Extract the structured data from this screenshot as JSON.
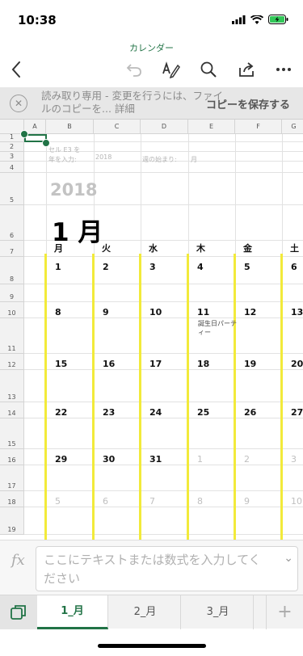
{
  "status": {
    "time": "10:38"
  },
  "app": {
    "title": "カレンダー"
  },
  "banner": {
    "message": "読み取り専用 - 変更を行うには、ファイルのコピーを... 詳細",
    "save_label": "コピーを保存する"
  },
  "sheet": {
    "columns": [
      "A",
      "B",
      "C",
      "D",
      "E",
      "F",
      "G"
    ],
    "rows": [
      "1",
      "2",
      "3",
      "4",
      "5",
      "6",
      "7",
      "8",
      "9",
      "10",
      "11",
      "12",
      "13",
      "14",
      "15",
      "16",
      "17",
      "18",
      "19"
    ],
    "b2": "セル E3 を",
    "b3": "年を入力:",
    "c3": "2018",
    "d3": "週の始まり:",
    "e3": "月",
    "year": "2018",
    "month": "1 月",
    "weekdays": [
      "月",
      "火",
      "水",
      "木",
      "金",
      "土"
    ],
    "week1": [
      "1",
      "2",
      "3",
      "4",
      "5",
      "6"
    ],
    "week2": [
      "8",
      "9",
      "10",
      "11",
      "12",
      "13"
    ],
    "week3": [
      "15",
      "16",
      "17",
      "18",
      "19",
      "20"
    ],
    "week4": [
      "22",
      "23",
      "24",
      "25",
      "26",
      "27"
    ],
    "week5": [
      "29",
      "30",
      "31",
      "1",
      "2",
      "3"
    ],
    "week6": [
      "5",
      "6",
      "7",
      "8",
      "9",
      "10"
    ],
    "note": "誕生日パーティー",
    "highlight_color": "#f2ea3a",
    "selection_color": "#217346"
  },
  "formula": {
    "placeholder": "ここにテキストまたは数式を入力してください"
  },
  "tabs": [
    {
      "label": "1_月",
      "active": true
    },
    {
      "label": "2_月",
      "active": false
    },
    {
      "label": "3_月",
      "active": false
    }
  ],
  "icons": [
    "back-icon",
    "undo-icon",
    "pen-icon",
    "search-icon",
    "share-icon",
    "more-icon",
    "sheets-icon",
    "plus-icon"
  ]
}
